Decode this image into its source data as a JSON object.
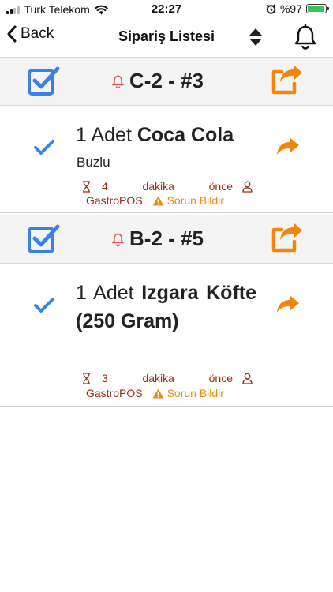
{
  "status_bar": {
    "carrier": "Turk Telekom",
    "time": "22:27",
    "battery": "%97",
    "battery_level_percent": 97
  },
  "nav": {
    "back_label": "Back",
    "title": "Sipariş Listesi",
    "icons": [
      "chevron-left-icon",
      "sort-icon",
      "bell-icon"
    ]
  },
  "orders": [
    {
      "title": "C-2 - #3",
      "item": {
        "qty_text": "1 Adet",
        "product": "Coca Cola",
        "note": "Buzlu",
        "minutes": "4",
        "unit": "dakika",
        "ago": "önce",
        "user": "GastroPOS",
        "report_label": "Sorun Bildir"
      }
    },
    {
      "title": "B-2 - #5",
      "item": {
        "qty_text": "1 Adet",
        "product": "Izgara Köfte (250 Gram)",
        "minutes": "3",
        "unit": "dakika",
        "ago": "önce",
        "user": "GastroPOS",
        "report_label": "Sorun Bildir"
      }
    }
  ],
  "colors": {
    "primary_blue": "#3b82e8",
    "share_orange": "#f2850f",
    "bell_red": "#d9534f",
    "meta_brown": "#9b2c12",
    "warning_orange": "#f08a0c",
    "header_bg": "#f4f4f4"
  }
}
